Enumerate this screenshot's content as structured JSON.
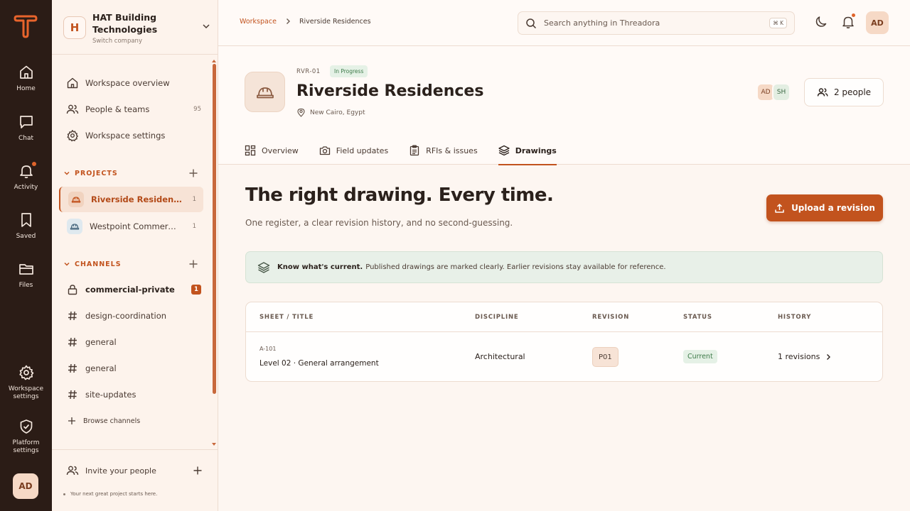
{
  "colors": {
    "accent": "#c2531e",
    "rail_bg": "#2b1c16",
    "success": "#3d7a48",
    "notify_dot": "#e0642b"
  },
  "rail": {
    "logo_icon": "threadora-logo-icon",
    "items": [
      {
        "label": "Home",
        "icon": "home-icon"
      },
      {
        "label": "Chat",
        "icon": "chat-icon"
      },
      {
        "label": "Activity",
        "icon": "bell-icon"
      },
      {
        "label": "Saved",
        "icon": "bookmark-icon"
      },
      {
        "label": "Files",
        "icon": "folder-icon"
      }
    ],
    "workspace_settings": "Workspace settings",
    "platform_settings": "Platform settings",
    "avatar": "AD"
  },
  "sidebar": {
    "company": {
      "initial": "H",
      "name": "HAT Building Technologies",
      "switch_label": "Switch company"
    },
    "nav": [
      {
        "label": "Workspace overview",
        "count": ""
      },
      {
        "label": "People & teams",
        "count": "95"
      },
      {
        "label": "Workspace settings",
        "count": ""
      }
    ],
    "projects_header": "PROJECTS",
    "projects": [
      {
        "label": "Riverside Residences",
        "count": "1"
      },
      {
        "label": "Westpoint Commercial Hub",
        "count": "1"
      }
    ],
    "channels_header": "CHANNELS",
    "channels": [
      {
        "label": "commercial-private",
        "badge": "1"
      },
      {
        "label": "design-coordination"
      },
      {
        "label": "general"
      },
      {
        "label": "general"
      },
      {
        "label": "site-updates"
      }
    ],
    "browse_channels": "Browse channels",
    "invite": "Invite your people",
    "tagline": "Your next great project starts here."
  },
  "topbar": {
    "breadcrumb": {
      "root": "Workspace",
      "current": "Riverside Residences"
    },
    "search_placeholder": "Search anything in Threadora",
    "shortcut": "⌘ K",
    "avatar": "AD"
  },
  "project": {
    "code": "RVR-01",
    "status": "In Progress",
    "title": "Riverside Residences",
    "location": "New Cairo, Egypt",
    "members": [
      "AD",
      "SH"
    ],
    "people_button": "2 people",
    "tabs": [
      {
        "label": "Overview",
        "icon": "grid-icon"
      },
      {
        "label": "Field updates",
        "icon": "camera-icon"
      },
      {
        "label": "RFIs & issues",
        "icon": "clipboard-icon"
      },
      {
        "label": "Drawings",
        "icon": "layers-icon"
      }
    ],
    "active_tab": "Drawings"
  },
  "drawings": {
    "title": "The right drawing. Every time.",
    "subtitle": "One register, a clear revision history, and no second-guessing.",
    "upload_button": "Upload a revision",
    "banner": {
      "bold": "Know what's current.",
      "text": "Published drawings are marked clearly. Earlier revisions stay available for reference."
    },
    "columns": [
      "SHEET / TITLE",
      "DISCIPLINE",
      "REVISION",
      "STATUS",
      "HISTORY"
    ],
    "rows": [
      {
        "code": "A-101",
        "title": "Level 02 · General arrangement",
        "discipline": "Architectural",
        "revision": "P01",
        "status": "Current",
        "history": "1 revisions"
      }
    ]
  }
}
